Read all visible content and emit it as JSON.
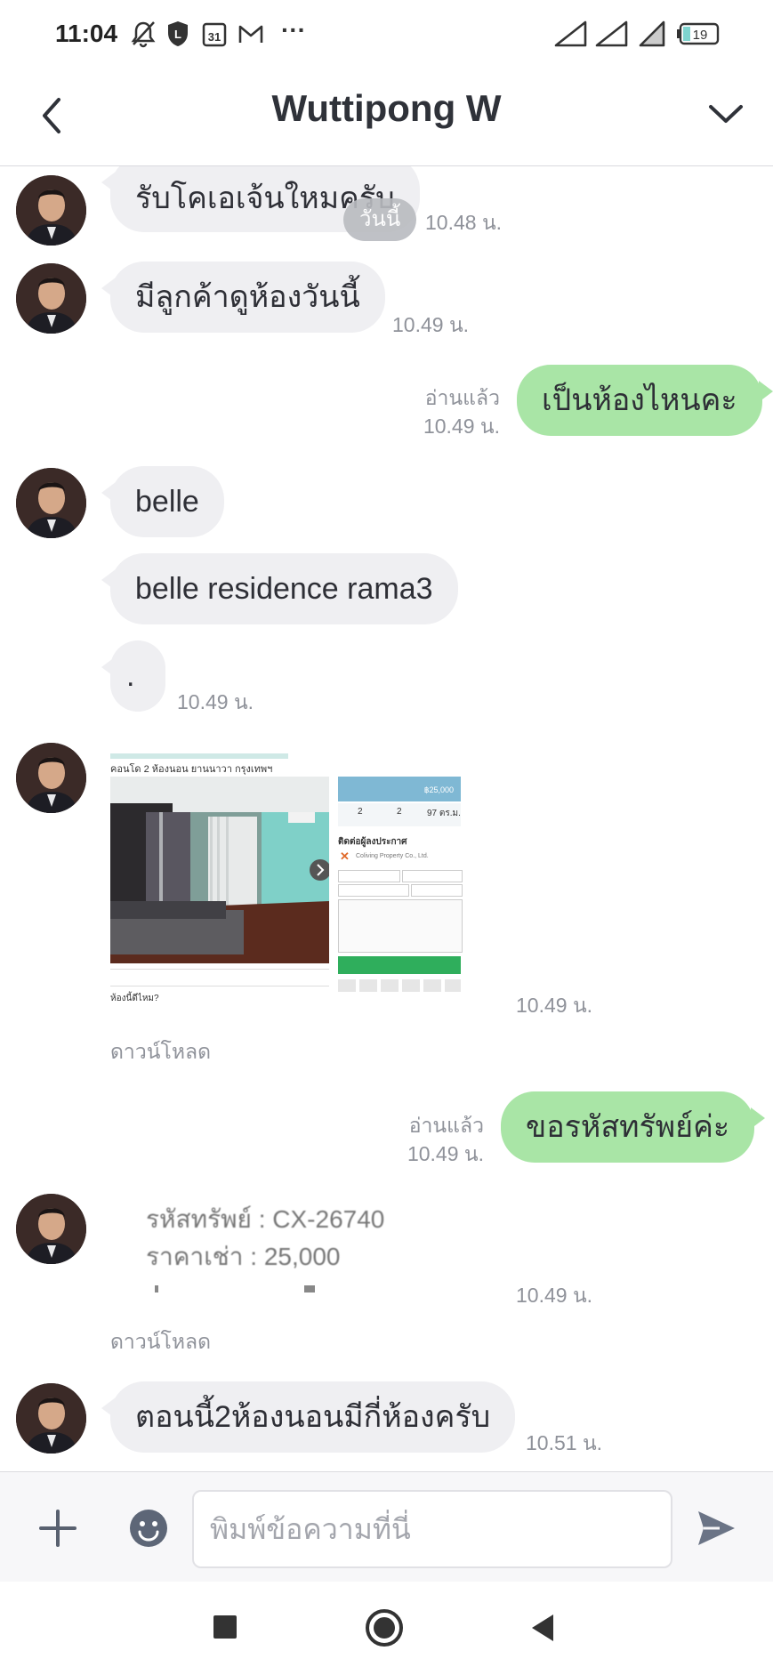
{
  "status_bar": {
    "time": "11:04",
    "calendar_day": "31",
    "battery": "19",
    "more": "···",
    "icons": [
      "mute-bell-icon",
      "shield-icon",
      "calendar-icon",
      "gmail-icon",
      "more-icon",
      "signal-icon",
      "signal-icon",
      "wifi-icon",
      "battery-icon"
    ]
  },
  "header": {
    "title": "Wuttipong W",
    "back_icon": "chevron-left-icon",
    "menu_icon": "chevron-down-icon"
  },
  "chat": {
    "date_pill": "วันนี้",
    "messages": [
      {
        "type": "received",
        "text": "รับโคเอเจ้นใหมครับ",
        "time": "10.48 น."
      },
      {
        "type": "received",
        "text": "มีลูกค้าดูห้องวันนี้",
        "time": "10.49 น."
      },
      {
        "type": "sent",
        "text": "เป็นห้องไหนคะ",
        "read": "อ่านแล้ว",
        "time": "10.49 น."
      },
      {
        "type": "received",
        "text": "belle"
      },
      {
        "type": "received",
        "text": "belle residence rama3"
      },
      {
        "type": "received",
        "text": ".",
        "time": "10.49 น."
      },
      {
        "type": "image",
        "download": "ดาวน์โหลด",
        "time": "10.49 น.",
        "listing": {
          "heading": "คอนโด 2 ห้องนอน ยานนาวา กรุงเทพฯ",
          "price": "฿25,000",
          "beds": "2",
          "baths": "2",
          "area": "97 ตร.ม.",
          "contact": "ติดต่อผู้ลงประกาศ",
          "agent": "Coliving Property Co., Ltd."
        }
      },
      {
        "type": "sent",
        "text": "ขอรหัสทรัพย์ค่ะ",
        "read": "อ่านแล้ว",
        "time": "10.49 น."
      },
      {
        "type": "text_image",
        "line1": "รหัสทรัพย์ : CX-26740",
        "line2": "ราคาเช่า : 25,000",
        "download": "ดาวน์โหลด",
        "time": "10.49 น."
      },
      {
        "type": "received",
        "text": "ตอนนี้2ห้องนอนมีกี่ห้องครับ",
        "time": "10.51 น."
      }
    ]
  },
  "composer": {
    "placeholder": "พิมพ์ข้อความที่นี่",
    "icons": [
      "plus-icon",
      "emoji-icon",
      "send-icon"
    ]
  },
  "nav": {
    "icons": [
      "recents-icon",
      "home-icon",
      "back-icon"
    ]
  }
}
